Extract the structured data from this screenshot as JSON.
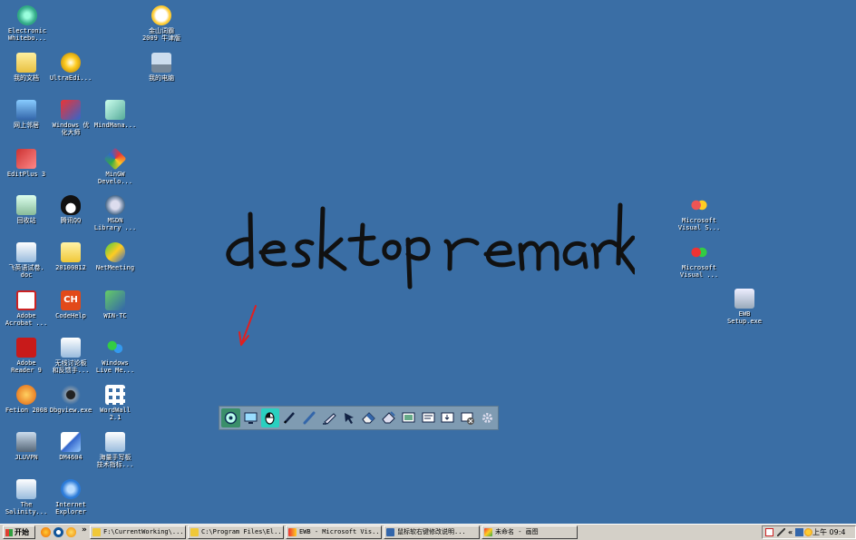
{
  "desktop": {
    "icons": [
      {
        "label": "Electronic\nWhitebo..."
      },
      {
        "label": "金山词霸\n2009 牛津版"
      },
      {
        "label": "我的文档"
      },
      {
        "label": "UltraEdi..."
      },
      {
        "label": "我的电脑"
      },
      {
        "label": "网上邻居"
      },
      {
        "label": "Windows 优\n化大师"
      },
      {
        "label": "MindMana..."
      },
      {
        "label": "EditPlus 3"
      },
      {
        "label": "MinGW\nDevelo..."
      },
      {
        "label": "回收站"
      },
      {
        "label": "腾讯QQ"
      },
      {
        "label": "MSDN\nLibrary ..."
      },
      {
        "label": "飞英语试卷.\ndoc"
      },
      {
        "label": "20100812"
      },
      {
        "label": "NetMeeting"
      },
      {
        "label": "Adobe\nAcrobat ..."
      },
      {
        "label": "CodeHelp"
      },
      {
        "label": "WIN-TC"
      },
      {
        "label": "Adobe\nReader 9"
      },
      {
        "label": "无线讨论板\n和反馈手..."
      },
      {
        "label": "Windows\nLive Me..."
      },
      {
        "label": "Fetion 2008"
      },
      {
        "label": "Dbgview.exe"
      },
      {
        "label": "WordWall\n2.1"
      },
      {
        "label": "JLUVPN"
      },
      {
        "label": "DM4604"
      },
      {
        "label": "海量手写板\n技术指标..."
      },
      {
        "label": "The\nSalinity..."
      },
      {
        "label": "Internet\nExplorer"
      },
      {
        "label": "Microsoft\nVisual S..."
      },
      {
        "label": "Microsoft\nVisual ..."
      },
      {
        "label": "EWB\nSetup.exe"
      }
    ],
    "annotation_text": "desktop remark"
  },
  "toolbar": {
    "tools": [
      "whiteboard-mode-icon",
      "desktop-mode-icon",
      "mouse-icon",
      "pen-icon",
      "brush-icon",
      "highlighter-icon",
      "pointer-icon",
      "eraser-icon",
      "clear-icon",
      "screenshot-icon",
      "page-icon",
      "save-icon",
      "close-icon",
      "settings-icon"
    ]
  },
  "taskbar": {
    "start_label": "开始",
    "overflow": "»",
    "tasks": [
      {
        "label": "F:\\CurrentWorking\\..."
      },
      {
        "label": "C:\\Program Files\\El..."
      },
      {
        "label": "EWB - Microsoft Vis..."
      },
      {
        "label": "鼠标软右键修改说明..."
      },
      {
        "label": "未命名 - 画图"
      }
    ],
    "tray_overflow": "«",
    "clock": "上午 09:4"
  },
  "colors": {
    "desktop": "#3a6ea5",
    "ink": "#111111",
    "arrow": "#e02020",
    "taskbar": "#d4d0c8"
  }
}
